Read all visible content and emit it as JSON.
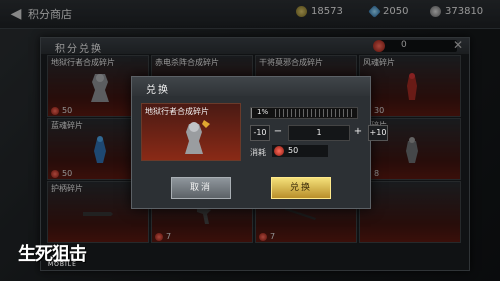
{
  "topbar": {
    "title": "积分商店",
    "back_icon": "back-arrow-icon",
    "currencies": [
      {
        "icon": "gold-coin-icon",
        "value": "18573"
      },
      {
        "icon": "diamond-icon",
        "value": "2050"
      },
      {
        "icon": "silver-coin-icon",
        "value": "373810"
      }
    ]
  },
  "panel": {
    "title": "积分兑换",
    "points": "0",
    "close_icon": "close-icon"
  },
  "cards": [
    {
      "name": "地狱行者合成碎片",
      "price": "50"
    },
    {
      "name": "赤电杀阵合成碎片",
      "price": ""
    },
    {
      "name": "干将莫邪合成碎片",
      "price": ""
    },
    {
      "name": "风魂碎片",
      "price": "30"
    },
    {
      "name": "蓝魂碎片",
      "price": "50"
    },
    {
      "name": "",
      "price": ""
    },
    {
      "name": "",
      "price": ""
    },
    {
      "name": "激碎片",
      "price": "8"
    },
    {
      "name": "护柄碎片",
      "price": ""
    },
    {
      "name": "",
      "price": "7"
    },
    {
      "name": "",
      "price": "7"
    },
    {
      "name": "",
      "price": ""
    }
  ],
  "dialog": {
    "title": "兑换",
    "item_name": "地狱行者合成碎片",
    "progress_text": "1%",
    "progress": 0.01,
    "minus10": "-10",
    "minus1": "−",
    "quantity": "1",
    "plus1": "+",
    "plus10": "+10",
    "cost_label": "消耗",
    "cost_value": "50",
    "cancel_label": "取消",
    "confirm_label": "兑换"
  },
  "logo": {
    "title": "生死狙击",
    "subtitle": "MOBILE"
  }
}
